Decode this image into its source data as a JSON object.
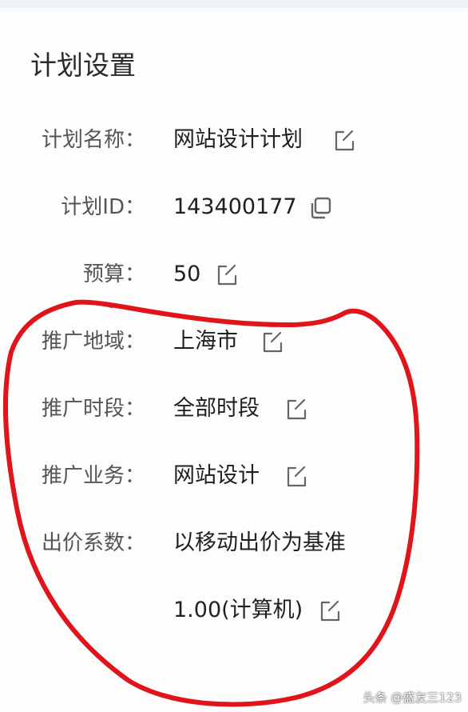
{
  "panel": {
    "title": "计划设置"
  },
  "fields": {
    "plan_name": {
      "label": "计划名称：",
      "value": "网站设计计划",
      "icon": "edit-icon"
    },
    "plan_id": {
      "label": "计划ID：",
      "value": "143400177",
      "icon": "copy-icon"
    },
    "budget": {
      "label": "预算：",
      "value": "50",
      "icon": "edit-icon"
    },
    "region": {
      "label": "推广地域：",
      "value": "上海市",
      "icon": "edit-icon"
    },
    "schedule": {
      "label": "推广时段：",
      "value": "全部时段",
      "icon": "edit-icon"
    },
    "business": {
      "label": "推广业务：",
      "value": "网站设计",
      "icon": "edit-icon"
    },
    "bid_factor": {
      "label": "出价系数：",
      "value_line1": "以移动出价为基准",
      "value_line2": "1.00(计算机)",
      "icon": "edit-icon"
    }
  },
  "watermark": "头条 @盛友三123",
  "colors": {
    "label": "#555555",
    "value": "#202020",
    "icon": "#666666",
    "annotation": "#e0151b",
    "topbar": "#eef1f6"
  }
}
